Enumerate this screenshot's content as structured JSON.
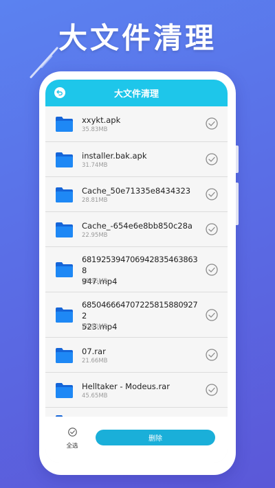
{
  "headline": "大文件清理",
  "screen": {
    "title": "大文件清理",
    "files": [
      {
        "name": "xxykt.apk",
        "size": "35.83MB"
      },
      {
        "name": "installer.bak.apk",
        "size": "31.74MB"
      },
      {
        "name": "Cache_50e71335e8434323",
        "size": "28.81MB"
      },
      {
        "name": "Cache_-654e6e8bb850c28a",
        "size": "22.95MB"
      },
      {
        "name": "681925394706942835463863 8947.mp4",
        "name_line1": "681925394706942835463863 8",
        "name_line2": "947.mp4",
        "size": "28.95MB"
      },
      {
        "name": "685046664707225815880927 2523.mp4",
        "name_line1": "685046664707225815880927 2",
        "name_line2": "523.mp4",
        "size": "20.80MB"
      },
      {
        "name": "07.rar",
        "size": "21.66MB"
      },
      {
        "name": "Helltaker - Modeus.rar",
        "size": "45.65MB"
      }
    ],
    "select_all_label": "全选",
    "delete_label": "删除"
  },
  "colors": {
    "titlebar": "#1ec6ea",
    "folder": "#1e88f5",
    "delete_button": "#1aafd9",
    "background": "#5b6ee6"
  },
  "icons": {
    "back": "back-icon",
    "folder": "folder-icon",
    "check": "check-circle-icon"
  }
}
